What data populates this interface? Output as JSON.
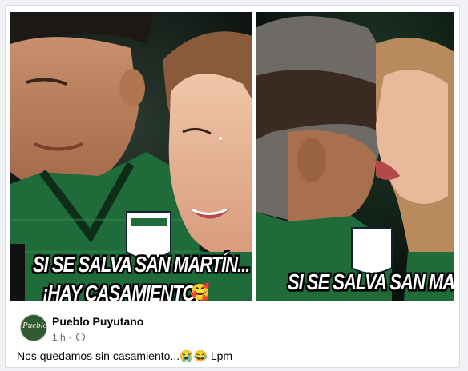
{
  "post": {
    "author": "Pueblo Puyutano",
    "time": "1 h",
    "time_sep": "·",
    "text": "Nos quedamos sin casamiento...😭😂 Lpm",
    "avatar_text": "Pueblo"
  },
  "image": {
    "caption_left_line1": "SI SE SALVA SAN MARTÍN...",
    "caption_left_line2": "¡HAY CASAMIENTO!",
    "caption_left_emoji": "🥰",
    "caption_right": "SI SE SALVA SAN MARTÍN"
  },
  "colors": {
    "jersey_green": "#1f6b3a",
    "card_bg": "#ffffff",
    "meta_text": "#65676b"
  },
  "icons": {
    "privacy": "globe-icon"
  }
}
